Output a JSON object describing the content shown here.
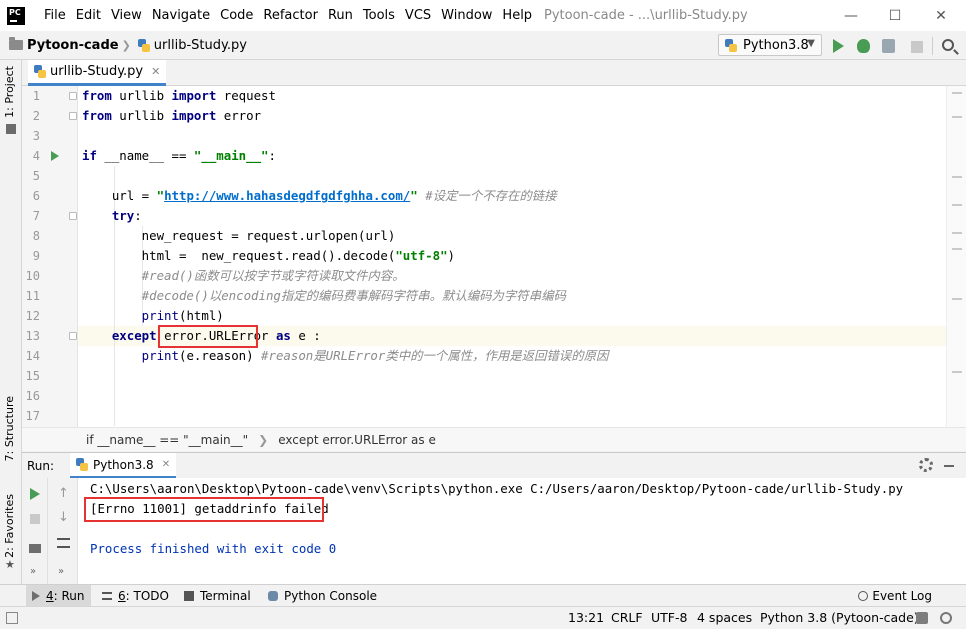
{
  "window": {
    "title": "Pytoon-cade - ...\\urllib-Study.py",
    "logo_text": "PC"
  },
  "menu": [
    "File",
    "Edit",
    "View",
    "Navigate",
    "Code",
    "Refactor",
    "Run",
    "Tools",
    "VCS",
    "Window",
    "Help"
  ],
  "navbar": {
    "project": "Pytoon-cade",
    "file": "urllib-Study.py",
    "run_config": "Python3.8"
  },
  "left_strip": {
    "project_tab": "1: Project",
    "structure_tab": "7: Structure",
    "favorites_tab": "2: Favorites"
  },
  "editor": {
    "tab_label": "urllib-Study.py",
    "line_numbers": [
      "1",
      "2",
      "3",
      "4",
      "5",
      "6",
      "7",
      "8",
      "9",
      "10",
      "11",
      "12",
      "13",
      "14",
      "15",
      "16",
      "17"
    ],
    "lines": {
      "l1": {
        "kw1": "from",
        "t1": " urllib ",
        "kw2": "import",
        "t2": " request"
      },
      "l2": {
        "kw1": "from",
        "t1": " urllib ",
        "kw2": "import",
        "t2": " error"
      },
      "l4": {
        "kw1": "if",
        "t1": " __name__ == ",
        "str": "\"__main__\"",
        "t2": ":"
      },
      "l6": {
        "t1": "    url = ",
        "q1": "\"",
        "url": "http://www.hahasdegdfgdfghha.com/",
        "q2": "\"",
        "cmt": " #设定一个不存在的链接"
      },
      "l7": {
        "kw": "    try",
        "t1": ":"
      },
      "l8": {
        "t1": "        new_request = request.urlopen(url)"
      },
      "l9": {
        "t1": "        html =  new_request.read().decode(",
        "str": "\"utf-8\"",
        "t2": ")"
      },
      "l10": {
        "cmt": "        #read()函数可以按字节或字符读取文件内容。"
      },
      "l11": {
        "cmt": "        #decode()以encoding指定的编码费事解码字符串。默认编码为字符串编码"
      },
      "l12": {
        "b": "        print",
        "t1": "(html)"
      },
      "l13": {
        "kw": "    except",
        "t1": " error.URLError ",
        "kw2": "as",
        "t2": " e :"
      },
      "l14": {
        "b": "        print",
        "t1": "(e.reason) ",
        "cmt": "#reason是URLError类中的一个属性，作用是返回错误的原因"
      }
    }
  },
  "code_breadcrumb": {
    "part1": "if __name__ == \"__main__\"",
    "part2": "except error.URLError as e"
  },
  "run_panel": {
    "label": "Run:",
    "tab": "Python3.8",
    "console": {
      "command": "C:\\Users\\aaron\\Desktop\\Pytoon-cade\\venv\\Scripts\\python.exe C:/Users/aaron/Desktop/Pytoon-cade/urllib-Study.py",
      "error": "[Errno 11001] getaddrinfo failed",
      "exit": "Process finished with exit code 0"
    }
  },
  "bottom_tabs": {
    "run_num": "4",
    "run": ": Run",
    "todo_num": "6",
    "todo": ": TODO",
    "terminal": "Terminal",
    "python_console": "Python Console",
    "event_log": "Event Log"
  },
  "status": {
    "position": "13:21",
    "line_sep": "CRLF",
    "encoding": "UTF-8",
    "indent": "4 spaces",
    "interpreter": "Python 3.8 (Pytoon-cade)"
  },
  "colors": {
    "accent": "#4083c9",
    "highlight_box": "#e53333",
    "run_green": "#499c54"
  }
}
